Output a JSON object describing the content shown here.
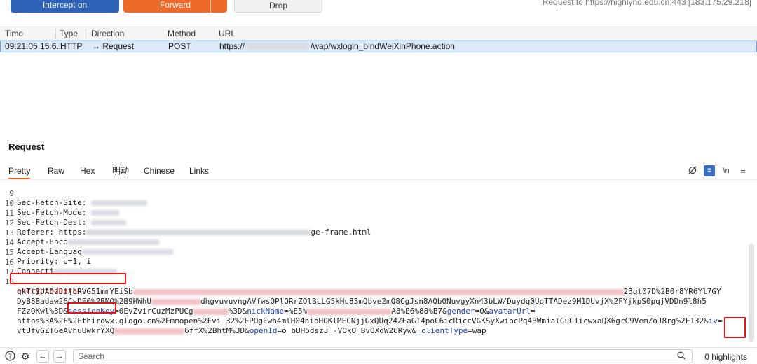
{
  "toolbar": {
    "intercept_label": "Intercept on",
    "forward_label": "Forward",
    "drop_label": "Drop",
    "target_text": "Request to https://highlynd.edu.cn:443 [183.175.29.218]"
  },
  "history": {
    "columns": [
      "Time",
      "Type",
      "Direction",
      "Method",
      "URL"
    ],
    "row": {
      "time": "09:21:05 15 6...",
      "type": "HTTP",
      "direction": "→ Request",
      "method": "POST",
      "url_prefix": "https://",
      "url_suffix": "/wap/wxlogin_bindWeiXinPhone.action"
    }
  },
  "request": {
    "title": "Request",
    "tabs": [
      "Pretty",
      "Raw",
      "Hex",
      "明动",
      "Chinese",
      "Links"
    ],
    "active_tab": "Pretty",
    "lines": [
      {
        "n": "9",
        "text": "Sec-Fetch-Site: "
      },
      {
        "n": "10",
        "text": "Sec-Fetch-Mode: "
      },
      {
        "n": "11",
        "text": "Sec-Fetch-Dest: "
      },
      {
        "n": "12",
        "text": "Referer: https:",
        "tail": "ge-frame.html"
      },
      {
        "n": "13",
        "text": "Accept-Enco"
      },
      {
        "n": "14",
        "text": "Accept-Languag"
      },
      {
        "n": "15",
        "text": "Priority: u=1, i"
      },
      {
        "n": "16",
        "text": "Connecti"
      },
      {
        "n": "17",
        "text": ""
      },
      {
        "n": "18",
        "text": ""
      }
    ],
    "body": {
      "key_encrypted": "encryptedData",
      "val_enc_1": "qkTt1UADzJijLRVG51mmYEiSb",
      "val_enc_1_tail": "23gt07D%2B0r8YR6Yl7GY",
      "val_enc_2": "DyB8Badaw26CsDE0%2BMQ%2B9HWhU",
      "val_enc_2_mid": "dhgvuvuvngAVfwsOPlQRrZOlBLLG5kHu83mQbve2mQ8CgJsn8AQb0NuvgyXn43bLW/Duydq0UqTTADez9M1DUvjX%2FYjkpS0pqjVDDn9l8h5",
      "val_enc_3": "FZzQKwl%3D&",
      "key_session": "sessionKey",
      "val_session": "0EvZvirCuzMzPUCg",
      "val_session_tail": "%3D&",
      "key_nickname": "nickName",
      "val_nickname": "%E5%",
      "val_nickname_tail": "A8%E6%88%B7&",
      "key_gender": "gender",
      "val_gender": "0&",
      "key_avatar": "avatarUrl",
      "val_avatar_1": "https%3A%2F%2Fthirdwx.qlogo.cn%2Fmmopen%2Fvi_32%2FPOgEwh4mlH04nibHOKlMECNjjGxQUq24ZEaGT4poC6icRiccVGKSyXwibcPq4BWmialGuG1icwxaQX6grC9VemZoJ8rg%2F132&",
      "key_iv": "iv",
      "val_iv": "vtUfvGZT6eAvhuUwkrYXQ",
      "val_iv_tail": "6ffX%2BhtM%3D&",
      "key_openid": "openId",
      "val_openid": "o_bUH5dsz3_-VOkO_BvOXdW26Ryw&",
      "key_client": "_clientType",
      "val_client": "wap"
    }
  },
  "footer": {
    "search_placeholder": "Search",
    "highlights": "0 highlights"
  }
}
